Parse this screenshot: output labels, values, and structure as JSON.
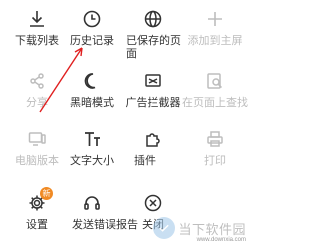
{
  "menu": {
    "rows": [
      [
        {
          "label": "下载列表",
          "icon": "download-icon",
          "enabled": true
        },
        {
          "label": "历史记录",
          "icon": "history-clock-icon",
          "enabled": true
        },
        {
          "label": "已保存的页面",
          "icon": "saved-page-globe-icon",
          "enabled": true
        },
        {
          "label": "添加到主屏",
          "icon": "add-to-home-icon",
          "enabled": false
        }
      ],
      [
        {
          "label": "分享",
          "icon": "share-icon",
          "enabled": false
        },
        {
          "label": "黑暗模式",
          "icon": "moon-icon",
          "enabled": true
        },
        {
          "label": "广告拦截器",
          "icon": "ad-blocker-icon",
          "enabled": true
        },
        {
          "label": "在页面上查找",
          "icon": "find-in-page-icon",
          "enabled": false
        }
      ],
      [
        {
          "label": "电脑版本",
          "icon": "desktop-version-icon",
          "enabled": false
        },
        {
          "label": "文字大小",
          "icon": "text-size-icon",
          "enabled": true
        },
        {
          "label": "插件",
          "icon": "plugin-icon",
          "enabled": true
        },
        {
          "label": "打印",
          "icon": "print-icon",
          "enabled": false
        }
      ],
      [
        {
          "label": "设置",
          "icon": "settings-gear-icon",
          "enabled": true,
          "badge": "新"
        },
        {
          "label": "发送错误报告",
          "icon": "headset-icon",
          "enabled": true
        },
        {
          "label": "关闭",
          "icon": "close-circle-icon",
          "enabled": true
        }
      ]
    ]
  },
  "colors": {
    "enabled_icon": "#333333",
    "disabled_icon": "#bdbdbd",
    "badge": "#f08a24",
    "arrow": "#e02020"
  },
  "watermark": {
    "text": "当下软件园",
    "url": "www.downxia.com"
  }
}
